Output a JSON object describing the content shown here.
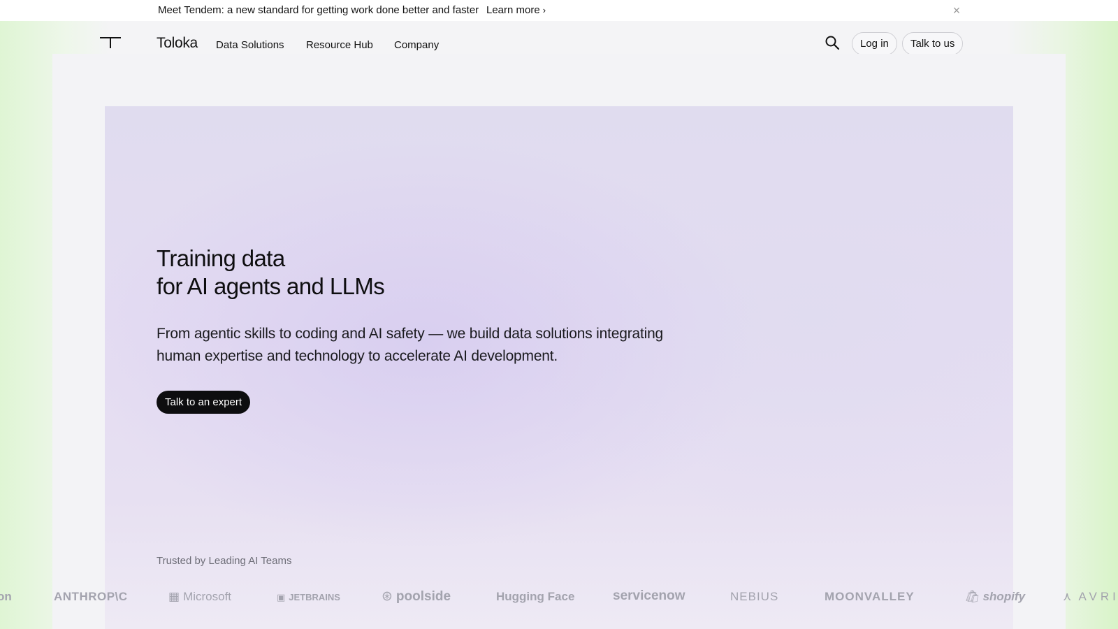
{
  "announcement": {
    "message": "Meet Tendem: a new standard for getting work done better and faster",
    "link_label": "Learn more",
    "link_chevron": "›",
    "close_glyph": "×"
  },
  "nav": {
    "brand": "Toloka",
    "links": [
      "Data Solutions",
      "Resource Hub",
      "Company"
    ],
    "search_icon": "search-icon",
    "login_label": "Log in",
    "talk_label": "Talk to us"
  },
  "hero": {
    "title_line1": "Training data",
    "title_line2": "for AI agents and LLMs",
    "subtitle": "From agentic skills to coding and AI safety — we build data solutions integrating human expertise and technology to accelerate AI development.",
    "cta_label": "Talk to an expert"
  },
  "trusted": {
    "label": "Trusted by Leading AI Teams",
    "logos": [
      {
        "name": "on",
        "glyph": ""
      },
      {
        "name": "ANTHROP\\C",
        "glyph": ""
      },
      {
        "name": "Microsoft",
        "glyph": "▦"
      },
      {
        "name": "JETBRAINS",
        "glyph": "▣"
      },
      {
        "name": "poolside",
        "glyph": "⊛"
      },
      {
        "name": "Hugging Face",
        "glyph": ""
      },
      {
        "name": "servicenow",
        "glyph": ""
      },
      {
        "name": "NEBIUS",
        "glyph": ""
      },
      {
        "name": "MOONVALLEY",
        "glyph": ""
      },
      {
        "name": "shopify",
        "glyph": "🛍"
      },
      {
        "name": "AVRI",
        "glyph": "⋏"
      }
    ]
  },
  "colors": {
    "accent_dark": "#0d0d0f",
    "hero_bg": "#e4dcf2",
    "logo_gray": "#a3a3ae"
  }
}
